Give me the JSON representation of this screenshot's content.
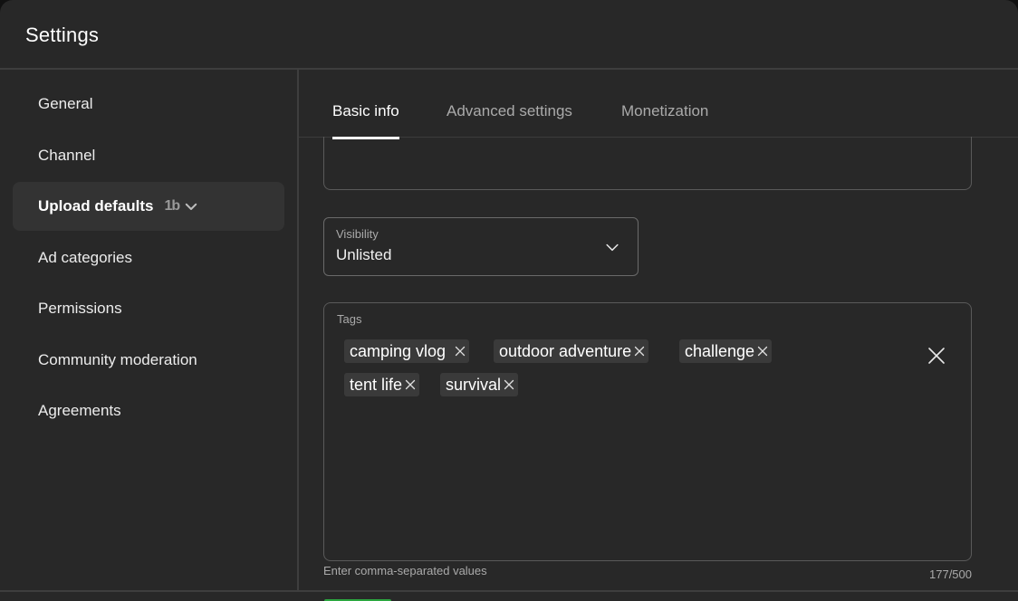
{
  "dialog": {
    "title": "Settings"
  },
  "sidebar": {
    "items": [
      {
        "label": "General"
      },
      {
        "label": "Channel"
      },
      {
        "label": "Upload defaults",
        "badge": "1b"
      },
      {
        "label": "Ad categories"
      },
      {
        "label": "Permissions"
      },
      {
        "label": "Community moderation"
      },
      {
        "label": "Agreements"
      }
    ],
    "active_index": 2
  },
  "tabs": [
    {
      "label": "Basic info"
    },
    {
      "label": "Advanced settings"
    },
    {
      "label": "Monetization"
    }
  ],
  "active_tab": "Basic info",
  "visibility": {
    "label": "Visibility",
    "value": "Unlisted"
  },
  "tags": {
    "label": "Tags",
    "chips": [
      {
        "text": "camping vlog"
      },
      {
        "text": "outdoor adventure"
      },
      {
        "text": "challenge"
      },
      {
        "text": "tent life"
      },
      {
        "text": "survival"
      }
    ],
    "hint": "Enter comma-separated values",
    "counter": "177/500"
  },
  "icons": {
    "chip_remove": "close-icon",
    "clear_all": "close-icon",
    "dropdown": "chevron-down-icon"
  },
  "colors": {
    "background": "#282828",
    "accent_green": "#2ba640"
  }
}
